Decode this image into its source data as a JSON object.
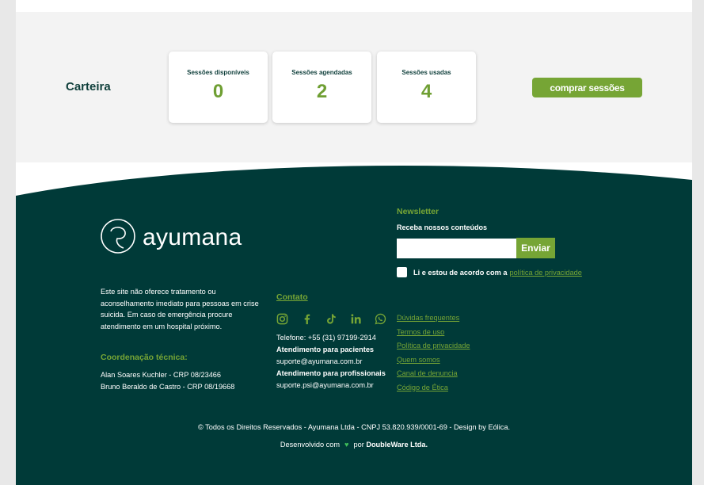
{
  "colors": {
    "dark_green": "#003a38",
    "accent_green": "#76a535",
    "light_bg": "#f3f3f3"
  },
  "wallet": {
    "label": "Carteira",
    "cards": [
      {
        "title": "Sessões disponíveis",
        "value": "0"
      },
      {
        "title": "Sessões agendadas",
        "value": "2"
      },
      {
        "title": "Sessões usadas",
        "value": "4"
      }
    ],
    "buy_label": "comprar sessões"
  },
  "footer": {
    "logo_text": "ayumana",
    "logo_icon": "speech-bubble-icon",
    "disclaimer": "Este site não oferece tratamento ou aconselhamento imediato para pessoas em crise suicida. Em caso de emergência procure atendimento em um hospital próximo.",
    "coord_title": "Coordenação técnica:",
    "coord_names": [
      "Alan Soares Kuchler - CRP 08/23466",
      "Bruno Beraldo de Castro - CRP 08/19668"
    ],
    "contato": {
      "title": "Contato",
      "socials": [
        "instagram-icon",
        "facebook-icon",
        "tiktok-icon",
        "linkedin-icon",
        "whatsapp-icon"
      ],
      "phone": "Telefone: +55 (31) 97199-2914",
      "patients_label": "Atendimento para pacientes",
      "patients_email": "suporte@ayumana.com.br",
      "pros_label": "Atendimento para profissionais",
      "pros_email": "suporte.psi@ayumana.com.br"
    },
    "newsletter": {
      "title": "Newsletter",
      "subtitle": "Receba nossos conteúdos",
      "input_placeholder": "",
      "send_label": "Enviar",
      "consent_text": "Li e estou de acordo com a",
      "consent_link": "política de privacidade"
    },
    "links": [
      "Dúvidas frequentes",
      "Termos de uso",
      "Política de privacidade",
      "Quem somos",
      "Canal de denuncia",
      "Código de Ética"
    ],
    "copyright": "© Todos os Direitos Reservados - Ayumana Ltda - CNPJ 53.820.939/0001-69 - Design by Eólica.",
    "dev_prefix": "Desenvolvido com",
    "dev_by": "por",
    "dev_company": "DoubleWare Ltda."
  }
}
